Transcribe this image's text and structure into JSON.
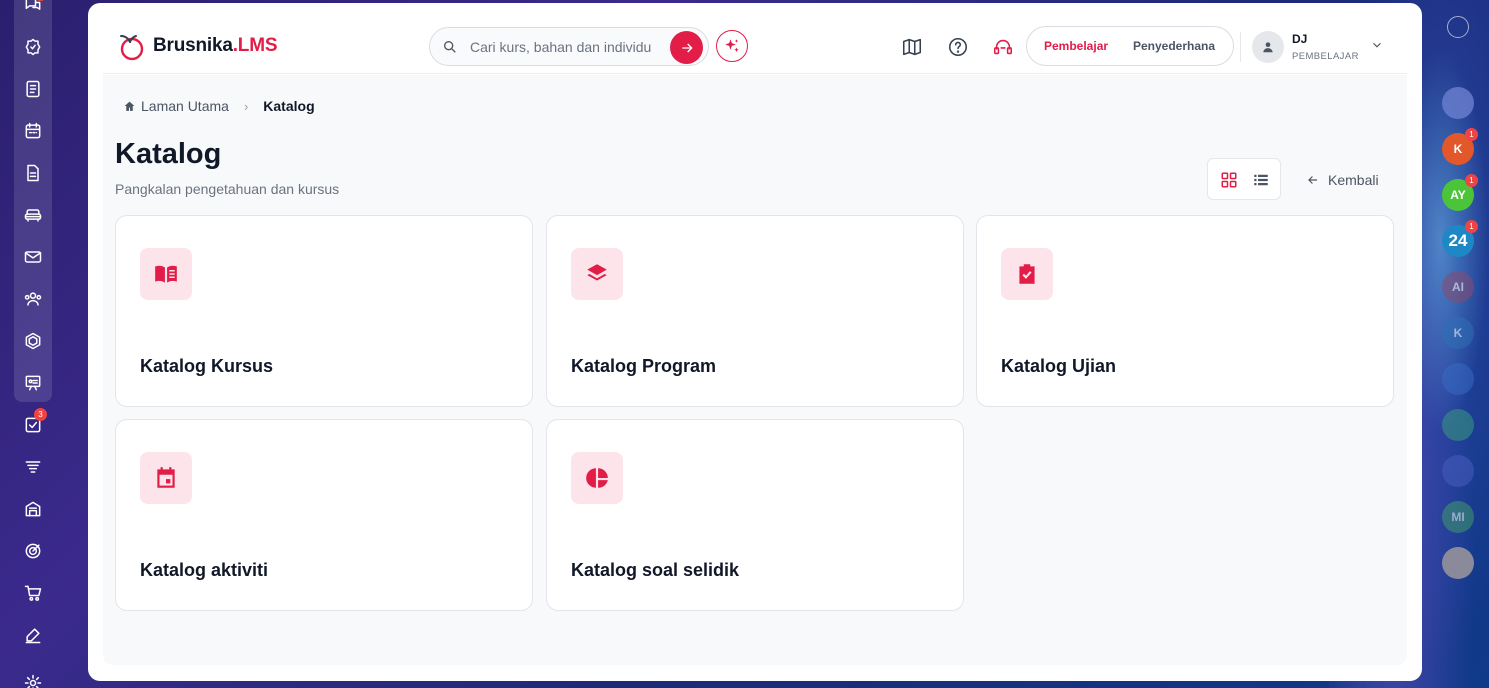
{
  "left_rail": {
    "icons": [
      {
        "name": "chat-bubbles-icon"
      },
      {
        "name": "badge-star-icon"
      },
      {
        "name": "document-list-icon"
      },
      {
        "name": "calendar-icon"
      },
      {
        "name": "file-text-icon"
      },
      {
        "name": "sofa-icon"
      },
      {
        "name": "mail-icon"
      },
      {
        "name": "users-icon"
      },
      {
        "name": "hexagon-icon"
      },
      {
        "name": "presentation-board-icon"
      },
      {
        "name": "tasks-check-icon",
        "badge": "3"
      },
      {
        "name": "layers-funnel-icon"
      },
      {
        "name": "building-icon"
      },
      {
        "name": "target-icon"
      },
      {
        "name": "cart-icon"
      },
      {
        "name": "signature-icon"
      },
      {
        "name": "settings-icon"
      }
    ]
  },
  "header": {
    "logo": {
      "brand": "Brusnika",
      "suffix": ".LMS"
    },
    "search": {
      "placeholder": "Cari kurs, bahan dan individu"
    },
    "role_toggle": {
      "active": "Pembelajar",
      "inactive": "Penyederhana"
    },
    "user": {
      "name": "DJ",
      "role": "PEMBELAJAR"
    }
  },
  "breadcrumb": {
    "home": "Laman Utama",
    "current": "Katalog"
  },
  "page": {
    "title": "Katalog",
    "subtitle": "Pangkalan pengetahuan dan kursus",
    "back_label": "Kembali"
  },
  "cards": [
    {
      "title": "Katalog Kursus",
      "icon": "book-open-icon"
    },
    {
      "title": "Katalog Program",
      "icon": "layers-icon"
    },
    {
      "title": "Katalog Ujian",
      "icon": "clipboard-check-icon"
    },
    {
      "title": "Katalog aktiviti",
      "icon": "calendar-event-icon"
    },
    {
      "title": "Katalog soal selidik",
      "icon": "pie-chart-icon"
    }
  ],
  "right_rail": {
    "items": [
      {
        "label": "K",
        "badge": "1",
        "color": "#e2582b"
      },
      {
        "label": "AY",
        "badge": "1",
        "color": "#4cc43a"
      },
      {
        "label": "24",
        "badge": "1",
        "color": "#1e88c7"
      },
      {
        "label": "AI",
        "color": "#8a4a6e"
      },
      {
        "label": "K",
        "color": "#2f6fb5"
      },
      {
        "label": "MI",
        "color": "#3f9a6a"
      }
    ]
  },
  "colors": {
    "accent": "#e11d48",
    "accent_soft": "#fde4ea"
  }
}
